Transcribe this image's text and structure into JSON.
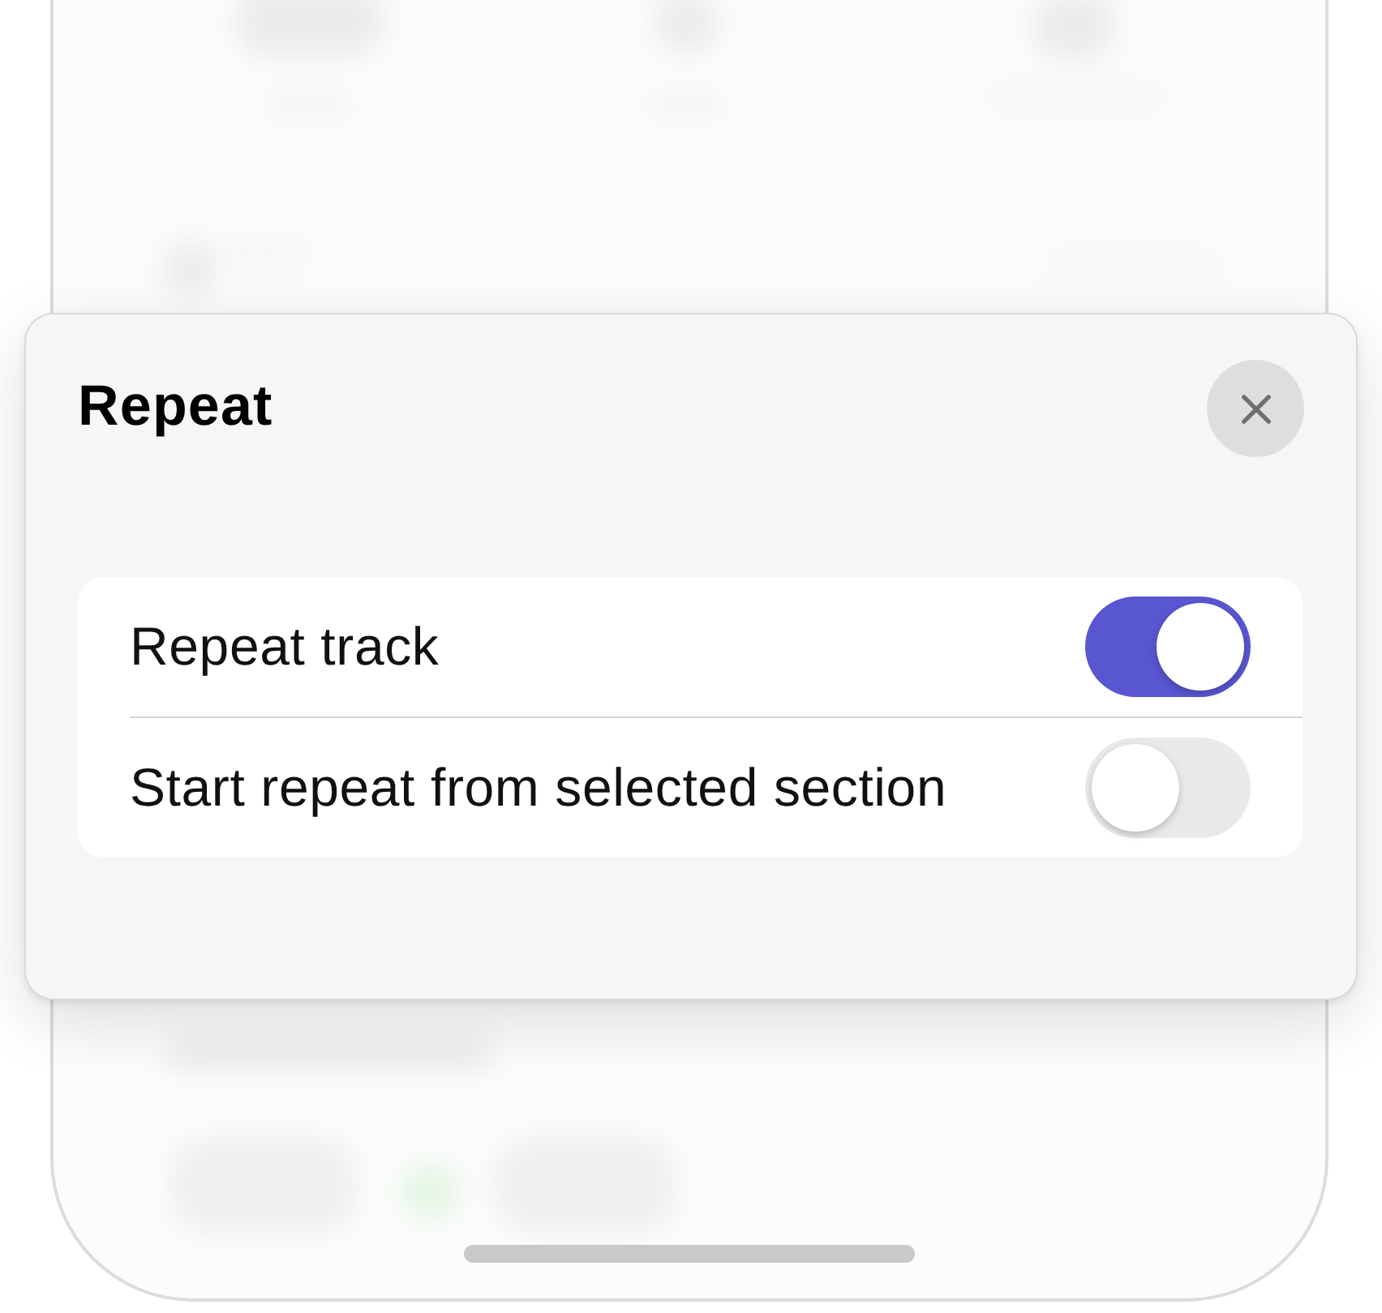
{
  "sheet": {
    "title": "Repeat",
    "rows": [
      {
        "label": "Repeat track",
        "on": true
      },
      {
        "label": "Start repeat from selected section",
        "on": false
      }
    ]
  }
}
